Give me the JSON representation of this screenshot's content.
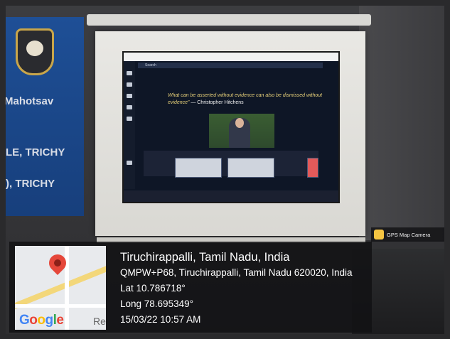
{
  "banner": {
    "line1": "Mahotsav",
    "line2": "LE, TRICHY",
    "line3": "), TRICHY"
  },
  "projection": {
    "search_label": "Search",
    "quote": "What can be asserted without evidence can also be dismissed without evidence”",
    "quote_author": "— Christopher Hitchens"
  },
  "gps_badge": {
    "label": "GPS Map Camera"
  },
  "map": {
    "logo_letters": [
      "G",
      "o",
      "o",
      "g",
      "l",
      "e"
    ],
    "edge_text": "Re"
  },
  "location": {
    "place": "Tiruchirappalli, Tamil Nadu, India",
    "address": "QMPW+P68, Tiruchirappalli, Tamil Nadu 620020, India",
    "lat": "Lat 10.786718°",
    "long": "Long 78.695349°",
    "datetime": "15/03/22 10:57 AM"
  }
}
